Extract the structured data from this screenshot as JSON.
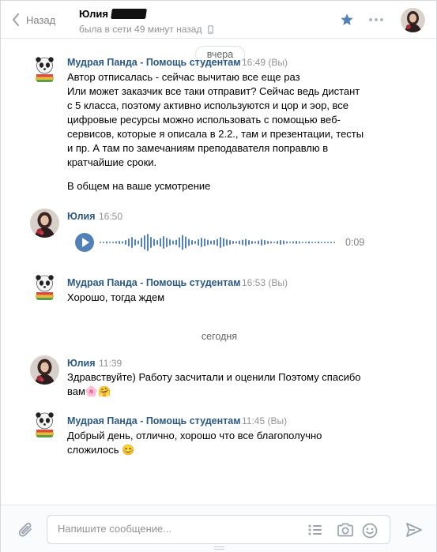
{
  "header": {
    "back_label": "Назад",
    "peer_name": "Юлия",
    "peer_status": "была в сети 49 минут назад"
  },
  "days": {
    "yesterday": "вчера",
    "today": "сегодня"
  },
  "messages": [
    {
      "author": "Мудрая Панда - Помощь студентам",
      "time": "16:49 (Вы)",
      "lines": [
        "Автор отписалась - сейчас вычитаю все еще раз",
        "Или может заказчик все таки отправит? Сейчас ведь дистант",
        "с 5 класса, поэтому активно используются и цор и эор, все",
        "цифровые ресурсы можно использовать с помощью веб-",
        "сервисов, которые я описала в 2.2., там и презентации, тесты",
        "и пр. А там по замечаниям преподавателя поправлю в",
        "кратчайшие сроки."
      ],
      "extra": "В общем на ваше усмотрение"
    },
    {
      "author": "Юлия",
      "time": "16:50",
      "audio_duration": "0:09"
    },
    {
      "author": "Мудрая Панда - Помощь студентам",
      "time": "16:53 (Вы)",
      "text": "Хорошо, тогда ждем"
    },
    {
      "author": "Юлия",
      "time": "11:39",
      "lines": [
        "Здравствуйте) Работу засчитали и оценили Поэтому спасибо",
        "вам🌸🤗"
      ]
    },
    {
      "author": "Мудрая Панда - Помощь студентам",
      "time": "11:45 (Вы)",
      "lines": [
        "Добрый день, отлично, хорошо что все благополучно",
        "сложилось 😊"
      ]
    }
  ],
  "composer": {
    "placeholder": "Напишите сообщение..."
  },
  "colors": {
    "link": "#2a5885",
    "accent": "#5181b8",
    "muted": "#939393"
  }
}
